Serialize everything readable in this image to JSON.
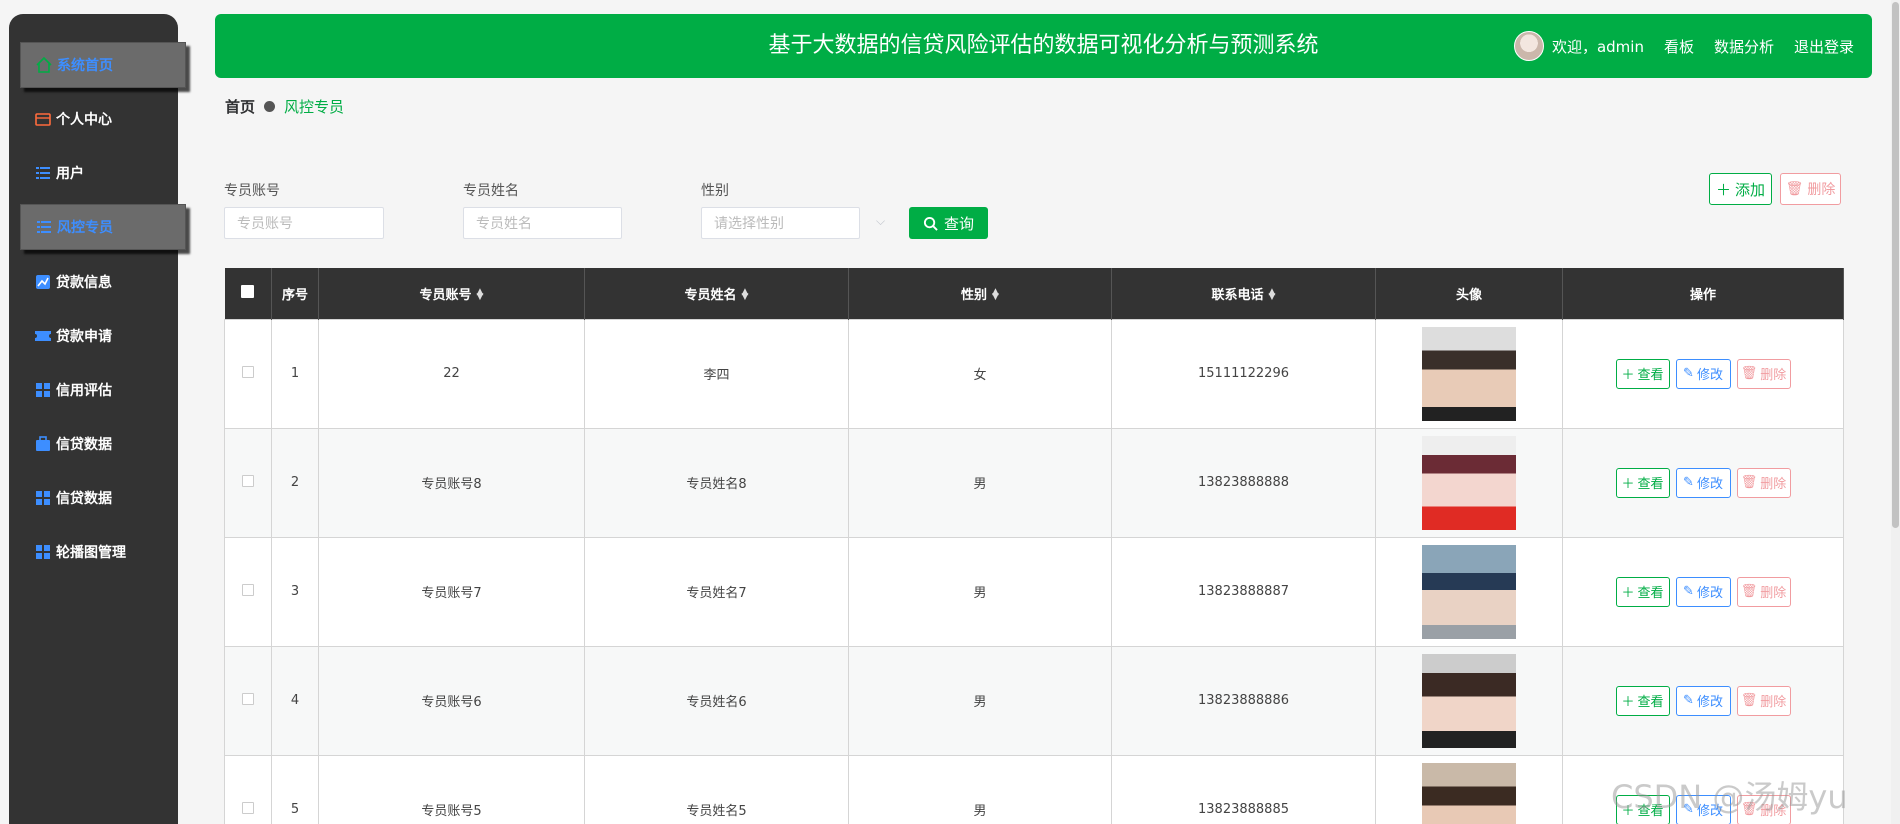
{
  "header": {
    "title": "基于大数据的信贷风险评估的数据可视化分析与预测系统",
    "welcome": "欢迎，admin",
    "links": [
      "看板",
      "数据分析",
      "退出登录"
    ]
  },
  "sidebar": {
    "items": [
      {
        "label": "系统首页",
        "icon": "home-icon",
        "active": true
      },
      {
        "label": "个人中心",
        "icon": "wallet-icon",
        "active": false
      },
      {
        "label": "用户",
        "icon": "list-icon",
        "active": false
      },
      {
        "label": "风控专员",
        "icon": "list-icon",
        "active": true
      },
      {
        "label": "贷款信息",
        "icon": "chart-icon",
        "active": false
      },
      {
        "label": "贷款申请",
        "icon": "ticket-icon",
        "active": false
      },
      {
        "label": "信用评估",
        "icon": "grid-icon",
        "active": false
      },
      {
        "label": "信贷数据",
        "icon": "briefcase-icon",
        "active": false
      },
      {
        "label": "信贷数据",
        "icon": "grid-icon",
        "active": false
      },
      {
        "label": "轮播图管理",
        "icon": "grid-icon",
        "active": false
      }
    ]
  },
  "breadcrumb": {
    "home": "首页",
    "current": "风控专员"
  },
  "search": {
    "account_label": "专员账号",
    "account_placeholder": "专员账号",
    "name_label": "专员姓名",
    "name_placeholder": "专员姓名",
    "gender_label": "性别",
    "gender_placeholder": "请选择性别",
    "query_label": "查询"
  },
  "toolbar": {
    "add_label": "添加",
    "delete_label": "删除"
  },
  "table": {
    "headers": [
      "序号",
      "专员账号",
      "专员姓名",
      "性别",
      "联系电话",
      "头像",
      "操作"
    ],
    "rows": [
      {
        "index": "1",
        "account": "22",
        "name": "李四",
        "gender": "女",
        "phone": "15111122296"
      },
      {
        "index": "2",
        "account": "专员账号8",
        "name": "专员姓名8",
        "gender": "男",
        "phone": "13823888888"
      },
      {
        "index": "3",
        "account": "专员账号7",
        "name": "专员姓名7",
        "gender": "男",
        "phone": "13823888887"
      },
      {
        "index": "4",
        "account": "专员账号6",
        "name": "专员姓名6",
        "gender": "男",
        "phone": "13823888886"
      },
      {
        "index": "5",
        "account": "专员账号5",
        "name": "专员姓名5",
        "gender": "男",
        "phone": "13823888885"
      }
    ],
    "actions": {
      "view": "查看",
      "edit": "修改",
      "delete": "删除"
    }
  },
  "watermark": "CSDN @汤姆yu",
  "colors": {
    "primary": "#00ad45",
    "sidebar": "#333333",
    "edit": "#3d8eff",
    "danger": "#f19ca0"
  }
}
